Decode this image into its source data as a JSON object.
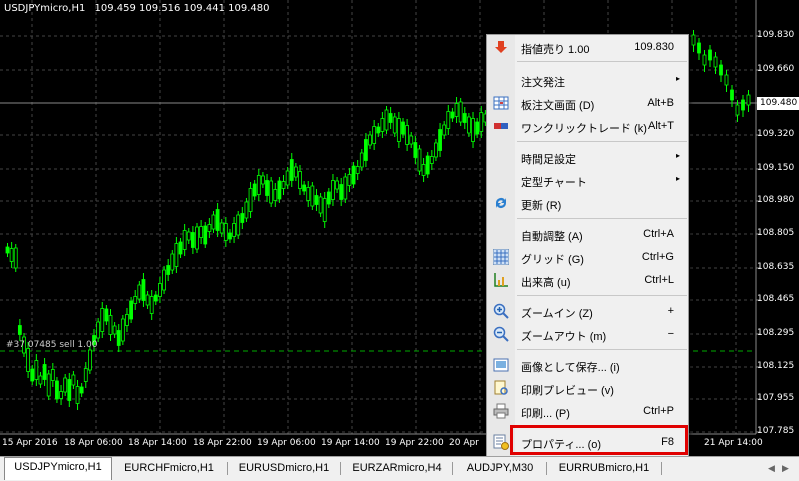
{
  "chart": {
    "title_symbol": "USDJPYmicro,H1",
    "title_ohlc": "109.459 109.516 109.441 109.480",
    "order_label": "#37 07485 sell 1.00",
    "current_price": "109.480",
    "price_labels": [
      "109.830",
      "109.660",
      "109.480",
      "109.320",
      "109.150",
      "108.980",
      "108.805",
      "108.635",
      "108.465",
      "108.295",
      "108.125",
      "107.955",
      "107.785"
    ],
    "time_labels": [
      "15 Apr 2016",
      "18 Apr 06:00",
      "18 Apr 14:00",
      "18 Apr 22:00",
      "19 Apr 06:00",
      "19 Apr 14:00",
      "19 Apr 22:00",
      "20 Apr",
      "21 Apr 14:00"
    ],
    "colors": {
      "background": "#000000",
      "candle": "#00ff00",
      "grid": "#444444",
      "order_line": "#00aa00"
    }
  },
  "context_menu": {
    "items": [
      {
        "label": "指値売り 1.00",
        "shortcut": "109.830",
        "icon": "sell-arrow-icon"
      },
      {
        "label": "注文発注",
        "submenu": "▸"
      },
      {
        "label": "板注文画面 (D)",
        "shortcut": "Alt+B",
        "icon": "order-book-icon"
      },
      {
        "label": "ワンクリックトレード (k)",
        "shortcut": "Alt+T",
        "icon": "one-click-icon"
      },
      {
        "label": "時間足設定",
        "submenu": "▸"
      },
      {
        "label": "定型チャート",
        "submenu": "▸"
      },
      {
        "label": "更新 (R)",
        "icon": "refresh-icon"
      },
      {
        "label": "自動調整 (A)",
        "shortcut": "Ctrl+A"
      },
      {
        "label": "グリッド (G)",
        "shortcut": "Ctrl+G",
        "icon": "grid-icon"
      },
      {
        "label": "出来高 (u)",
        "shortcut": "Ctrl+L",
        "icon": "volume-icon"
      },
      {
        "label": "ズームイン (Z)",
        "shortcut": "+",
        "icon": "zoom-in-icon"
      },
      {
        "label": "ズームアウト (m)",
        "shortcut": "−",
        "icon": "zoom-out-icon"
      },
      {
        "label": "画像として保存... (i)",
        "icon": "save-image-icon"
      },
      {
        "label": "印刷プレビュー (v)",
        "icon": "print-preview-icon"
      },
      {
        "label": "印刷... (P)",
        "shortcut": "Ctrl+P",
        "icon": "print-icon"
      },
      {
        "label": "プロパティ... (o)",
        "shortcut": "F8",
        "icon": "properties-icon"
      }
    ]
  },
  "tabs": [
    "USDJPYmicro,H1",
    "EURCHFmicro,H1",
    "EURUSDmicro,H1",
    "EURZARmicro,H4",
    "AUDJPY,M30",
    "EURRUBmicro,H1"
  ]
}
